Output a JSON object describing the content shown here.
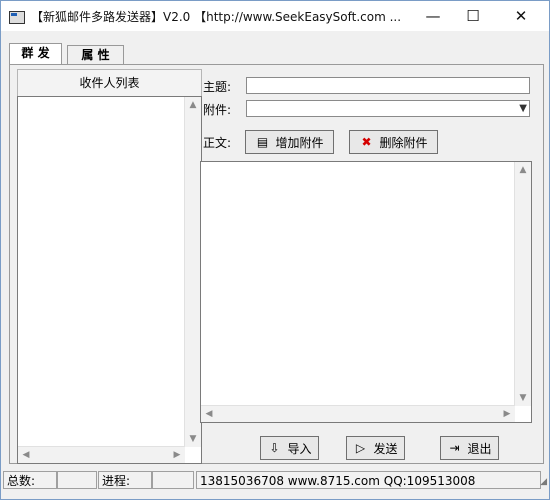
{
  "title": "【新狐邮件多路发送器】V2.0  【http://www.SeekEasySoft.com ...",
  "window_buttons": {
    "minimize": "—",
    "maximize": "☐",
    "close": "✕"
  },
  "tabs": [
    {
      "label": "群 发",
      "active": true
    },
    {
      "label": "属 性",
      "active": false
    }
  ],
  "recipients": {
    "header": "收件人列表",
    "items": []
  },
  "form": {
    "subject_label": "主题:",
    "subject_value": "",
    "attachment_label": "附件:",
    "attachment_value": "",
    "body_label": "正文:",
    "body_value": ""
  },
  "buttons": {
    "add_attachment": "增加附件",
    "delete_attachment": "删除附件",
    "import": "导入",
    "send": "发送",
    "exit": "退出"
  },
  "statusbar": {
    "total_label": "总数:",
    "total_value": "",
    "progress_label": "进程:",
    "progress_value": "",
    "info": "13815036708 www.8715.com QQ:109513008"
  },
  "icons": {
    "app": "app-icon",
    "add_attachment": "document-icon",
    "delete_attachment": "x-icon",
    "import": "import-icon",
    "send": "send-icon",
    "exit": "exit-icon"
  },
  "colors": {
    "accent": "#1f5fb4",
    "window_border": "#7a9cc6"
  }
}
